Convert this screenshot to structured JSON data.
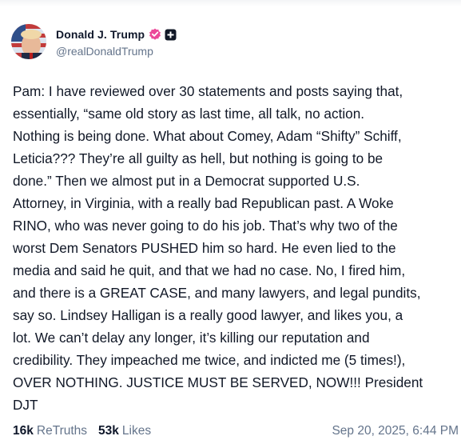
{
  "author": {
    "display_name": "Donald J. Trump",
    "handle": "@realDonaldTrump",
    "verified_icon": "verified-badge-icon",
    "plus_icon": "plus-icon"
  },
  "post": {
    "text": "Pam: I have reviewed over 30 statements and posts saying that,\nessentially, “same old story as last time, all talk, no action.\nNothing is being done. What about Comey, Adam “Shifty” Schiff,\nLeticia??? They’re all guilty as hell, but nothing is going to be\ndone.” Then we almost put in a Democrat supported U.S.\nAttorney, in Virginia, with a really bad Republican past. A Woke\nRINO, who was never going to do his job. That’s why two of the\nworst Dem Senators PUSHED him so hard. He even lied to the\nmedia and said he quit, and that we had no case. No, I fired him,\nand there is a GREAT CASE, and many lawyers, and legal pundits,\nsay so. Lindsey Halligan is a really good lawyer, and likes you, a\nlot. We can’t delay any longer, it’s killing our reputation and\ncredibility. They impeached me twice, and indicted me (5 times!),\nOVER NOTHING. JUSTICE MUST BE SERVED, NOW!!! President\nDJT"
  },
  "stats": {
    "retruths_count": "16k",
    "retruths_label": "ReTruths",
    "likes_count": "53k",
    "likes_label": "Likes",
    "timestamp": "Sep 20, 2025, 6:44 PM"
  },
  "colors": {
    "verified": "#ec4899",
    "muted_text": "#64748b",
    "body_text": "#111827"
  }
}
